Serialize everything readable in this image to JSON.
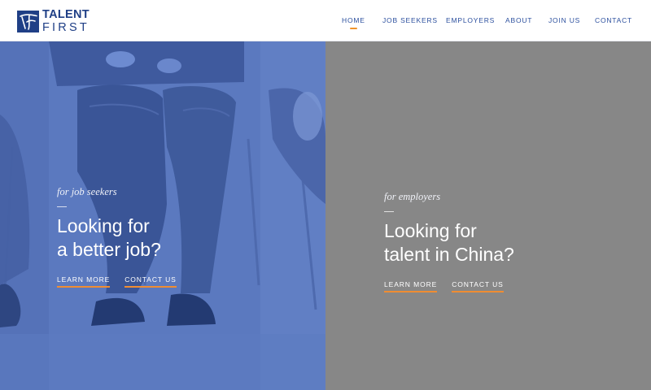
{
  "brand": {
    "line1": "TALENT",
    "line2": "FIRST",
    "color": "#1f3f86",
    "icon": "talent-first-logo-icon"
  },
  "nav": {
    "items": [
      {
        "label": "HOME",
        "active": true
      },
      {
        "label": "JOB SEEKERS",
        "active": false
      },
      {
        "label": "EMPLOYERS",
        "active": false
      },
      {
        "label": "ABOUT",
        "active": false
      },
      {
        "label": "JOIN US",
        "active": false
      },
      {
        "label": "CONTACT",
        "active": false
      }
    ],
    "active_indicator_color": "#f0942b"
  },
  "seekers": {
    "tagline": "for job seekers",
    "headline_line1": "Looking for",
    "headline_line2": "a better job?",
    "links": [
      "LEARN MORE",
      "CONTACT US"
    ],
    "background_color": "#5b79bf"
  },
  "employers": {
    "tagline": "for employers",
    "headline_line1": "Looking for",
    "headline_line2": "talent in China?",
    "links": [
      "LEARN MORE",
      "CONTACT US"
    ],
    "background_color": "#878787"
  },
  "accent_color": "#ef8d33"
}
